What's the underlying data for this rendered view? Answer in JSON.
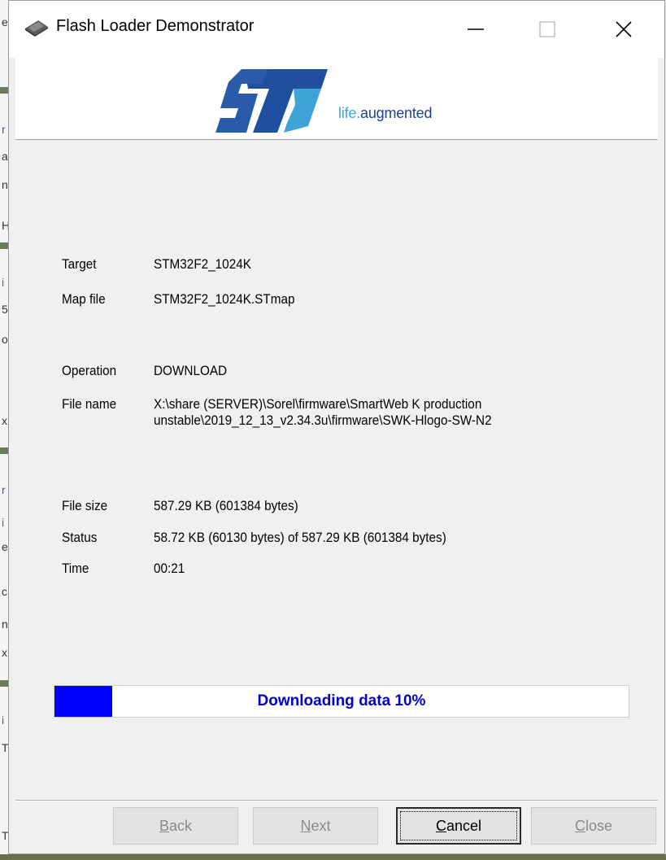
{
  "window": {
    "title": "Flash Loader Demonstrator",
    "app_icon": "chip-icon",
    "controls": {
      "minimize": "minimize-icon",
      "maximize": "maximize-icon",
      "close": "close-icon"
    }
  },
  "branding": {
    "logo_text": "ST",
    "tagline_prefix": "life.",
    "tagline_suffix": "augmented",
    "colors": {
      "logo_blue": "#1f4f9f",
      "tagline_light": "#3ea4d8",
      "tagline_dark": "#1f3f8f"
    }
  },
  "info": {
    "target_label": "Target",
    "target_value": "STM32F2_1024K",
    "map_label": "Map file",
    "map_value": "STM32F2_1024K.STmap",
    "operation_label": "Operation",
    "operation_value": "DOWNLOAD",
    "filename_label": "File name",
    "filename_line1": "X:\\share (SERVER)\\Sorel\\firmware\\SmartWeb K production",
    "filename_line2": "unstable\\2019_12_13_v2.34.3u\\firmware\\SWK-Hlogo-SW-N2",
    "filesize_label": "File size",
    "filesize_value": "587.29 KB (601384 bytes)",
    "status_label": "Status",
    "status_value": "58.72 KB (60130 bytes) of 587.29 KB (601384 bytes)",
    "time_label": "Time",
    "time_value": "00:21"
  },
  "progress": {
    "text": "Downloading data 10%",
    "fraction": 0.1,
    "fill_color": "#0000ff"
  },
  "buttons": {
    "back_mnemonic": "B",
    "back_rest": "ack",
    "next_mnemonic": "N",
    "next_rest": "ext",
    "cancel_mnemonic": "C",
    "cancel_rest": "ancel",
    "close_mnemonic": "C",
    "close_rest": "lose"
  }
}
